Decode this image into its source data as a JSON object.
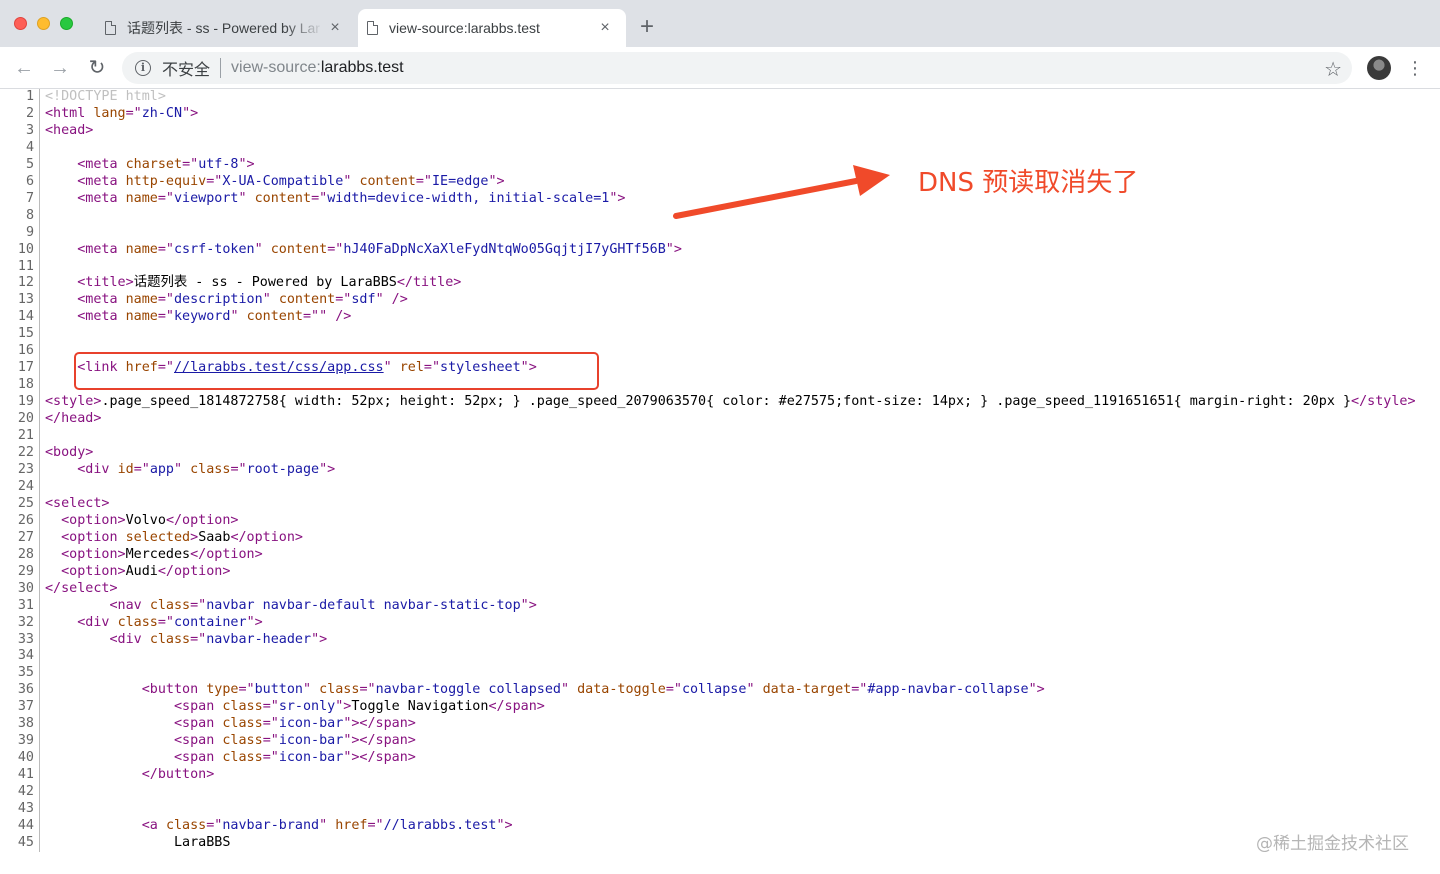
{
  "tabs": [
    {
      "title": "话题列表 - ss - Powered by Lar",
      "close": "×"
    },
    {
      "title": "view-source:larabbs.test",
      "close": "×"
    }
  ],
  "new_tab": "+",
  "toolbar": {
    "back": "←",
    "forward": "→",
    "reload": "↻",
    "info": "i",
    "security_label": "不安全",
    "url_scheme": "view-source:",
    "url_host": "larabbs.test",
    "star": "☆",
    "menu": "⋮"
  },
  "source_lines": [
    {
      "n": "1",
      "segs": [
        {
          "c": "doct",
          "t": "<!DOCTYPE html>"
        }
      ]
    },
    {
      "n": "2",
      "segs": [
        {
          "c": "tag",
          "t": "<html "
        },
        {
          "c": "an",
          "t": "lang"
        },
        {
          "c": "tag",
          "t": "=\""
        },
        {
          "c": "av",
          "t": "zh-CN"
        },
        {
          "c": "tag",
          "t": "\">"
        }
      ]
    },
    {
      "n": "3",
      "segs": [
        {
          "c": "tag",
          "t": "<head>"
        }
      ]
    },
    {
      "n": "4",
      "segs": []
    },
    {
      "n": "5",
      "segs": [
        {
          "c": "",
          "t": "    "
        },
        {
          "c": "tag",
          "t": "<meta "
        },
        {
          "c": "an",
          "t": "charset"
        },
        {
          "c": "tag",
          "t": "=\""
        },
        {
          "c": "av",
          "t": "utf-8"
        },
        {
          "c": "tag",
          "t": "\">"
        }
      ]
    },
    {
      "n": "6",
      "segs": [
        {
          "c": "",
          "t": "    "
        },
        {
          "c": "tag",
          "t": "<meta "
        },
        {
          "c": "an",
          "t": "http-equiv"
        },
        {
          "c": "tag",
          "t": "=\""
        },
        {
          "c": "av",
          "t": "X-UA-Compatible"
        },
        {
          "c": "tag",
          "t": "\" "
        },
        {
          "c": "an",
          "t": "content"
        },
        {
          "c": "tag",
          "t": "=\""
        },
        {
          "c": "av",
          "t": "IE=edge"
        },
        {
          "c": "tag",
          "t": "\">"
        }
      ]
    },
    {
      "n": "7",
      "segs": [
        {
          "c": "",
          "t": "    "
        },
        {
          "c": "tag",
          "t": "<meta "
        },
        {
          "c": "an",
          "t": "name"
        },
        {
          "c": "tag",
          "t": "=\""
        },
        {
          "c": "av",
          "t": "viewport"
        },
        {
          "c": "tag",
          "t": "\" "
        },
        {
          "c": "an",
          "t": "content"
        },
        {
          "c": "tag",
          "t": "=\""
        },
        {
          "c": "av",
          "t": "width=device-width, initial-scale=1"
        },
        {
          "c": "tag",
          "t": "\">"
        }
      ]
    },
    {
      "n": "8",
      "segs": []
    },
    {
      "n": "9",
      "segs": []
    },
    {
      "n": "10",
      "segs": [
        {
          "c": "",
          "t": "    "
        },
        {
          "c": "tag",
          "t": "<meta "
        },
        {
          "c": "an",
          "t": "name"
        },
        {
          "c": "tag",
          "t": "=\""
        },
        {
          "c": "av",
          "t": "csrf-token"
        },
        {
          "c": "tag",
          "t": "\" "
        },
        {
          "c": "an",
          "t": "content"
        },
        {
          "c": "tag",
          "t": "=\""
        },
        {
          "c": "av",
          "t": "hJ40FaDpNcXaXleFydNtqWo05GqjtjI7yGHTf56B"
        },
        {
          "c": "tag",
          "t": "\">"
        }
      ]
    },
    {
      "n": "11",
      "segs": []
    },
    {
      "n": "12",
      "segs": [
        {
          "c": "",
          "t": "    "
        },
        {
          "c": "tag",
          "t": "<title>"
        },
        {
          "c": "",
          "t": "话题列表 - ss - Powered by LaraBBS"
        },
        {
          "c": "tag",
          "t": "</title>"
        }
      ]
    },
    {
      "n": "13",
      "segs": [
        {
          "c": "",
          "t": "    "
        },
        {
          "c": "tag",
          "t": "<meta "
        },
        {
          "c": "an",
          "t": "name"
        },
        {
          "c": "tag",
          "t": "=\""
        },
        {
          "c": "av",
          "t": "description"
        },
        {
          "c": "tag",
          "t": "\" "
        },
        {
          "c": "an",
          "t": "content"
        },
        {
          "c": "tag",
          "t": "=\""
        },
        {
          "c": "av",
          "t": "sdf"
        },
        {
          "c": "tag",
          "t": "\" />"
        }
      ]
    },
    {
      "n": "14",
      "segs": [
        {
          "c": "",
          "t": "    "
        },
        {
          "c": "tag",
          "t": "<meta "
        },
        {
          "c": "an",
          "t": "name"
        },
        {
          "c": "tag",
          "t": "=\""
        },
        {
          "c": "av",
          "t": "keyword"
        },
        {
          "c": "tag",
          "t": "\" "
        },
        {
          "c": "an",
          "t": "content"
        },
        {
          "c": "tag",
          "t": "=\"\" />"
        }
      ]
    },
    {
      "n": "15",
      "segs": []
    },
    {
      "n": "16",
      "segs": []
    },
    {
      "n": "17",
      "segs": [
        {
          "c": "",
          "t": "    "
        },
        {
          "c": "tag",
          "t": "<link "
        },
        {
          "c": "an",
          "t": "href"
        },
        {
          "c": "tag",
          "t": "=\""
        },
        {
          "c": "lnk",
          "t": "//larabbs.test/css/app.css"
        },
        {
          "c": "tag",
          "t": "\" "
        },
        {
          "c": "an",
          "t": "rel"
        },
        {
          "c": "tag",
          "t": "=\""
        },
        {
          "c": "av",
          "t": "stylesheet"
        },
        {
          "c": "tag",
          "t": "\">"
        }
      ]
    },
    {
      "n": "18",
      "segs": []
    },
    {
      "n": "19",
      "wrap": true,
      "segs": [
        {
          "c": "tag",
          "t": "<style>"
        },
        {
          "c": "",
          "t": ".page_speed_1814872758{ width: 52px; height: 52px; } .page_speed_2079063570{ color: #e27575;font-size: 14px; } .page_speed_1191651651{ margin-right: 20px }"
        },
        {
          "c": "tag",
          "t": "</style>"
        }
      ]
    },
    {
      "n": "20",
      "segs": [
        {
          "c": "tag",
          "t": "</head>"
        }
      ]
    },
    {
      "n": "21",
      "segs": []
    },
    {
      "n": "22",
      "segs": [
        {
          "c": "tag",
          "t": "<body>"
        }
      ]
    },
    {
      "n": "23",
      "segs": [
        {
          "c": "",
          "t": "    "
        },
        {
          "c": "tag",
          "t": "<div "
        },
        {
          "c": "an",
          "t": "id"
        },
        {
          "c": "tag",
          "t": "=\""
        },
        {
          "c": "av",
          "t": "app"
        },
        {
          "c": "tag",
          "t": "\" "
        },
        {
          "c": "an",
          "t": "class"
        },
        {
          "c": "tag",
          "t": "=\""
        },
        {
          "c": "av",
          "t": "root-page"
        },
        {
          "c": "tag",
          "t": "\">"
        }
      ]
    },
    {
      "n": "24",
      "segs": []
    },
    {
      "n": "25",
      "segs": [
        {
          "c": "tag",
          "t": "<select>"
        }
      ]
    },
    {
      "n": "26",
      "segs": [
        {
          "c": "",
          "t": "  "
        },
        {
          "c": "tag",
          "t": "<option>"
        },
        {
          "c": "",
          "t": "Volvo"
        },
        {
          "c": "tag",
          "t": "</option>"
        }
      ]
    },
    {
      "n": "27",
      "segs": [
        {
          "c": "",
          "t": "  "
        },
        {
          "c": "tag",
          "t": "<option "
        },
        {
          "c": "an",
          "t": "selected"
        },
        {
          "c": "tag",
          "t": ">"
        },
        {
          "c": "",
          "t": "Saab"
        },
        {
          "c": "tag",
          "t": "</option>"
        }
      ]
    },
    {
      "n": "28",
      "segs": [
        {
          "c": "",
          "t": "  "
        },
        {
          "c": "tag",
          "t": "<option>"
        },
        {
          "c": "",
          "t": "Mercedes"
        },
        {
          "c": "tag",
          "t": "</option>"
        }
      ]
    },
    {
      "n": "29",
      "segs": [
        {
          "c": "",
          "t": "  "
        },
        {
          "c": "tag",
          "t": "<option>"
        },
        {
          "c": "",
          "t": "Audi"
        },
        {
          "c": "tag",
          "t": "</option>"
        }
      ]
    },
    {
      "n": "30",
      "segs": [
        {
          "c": "tag",
          "t": "</select>"
        }
      ]
    },
    {
      "n": "31",
      "segs": [
        {
          "c": "",
          "t": "        "
        },
        {
          "c": "tag",
          "t": "<nav "
        },
        {
          "c": "an",
          "t": "class"
        },
        {
          "c": "tag",
          "t": "=\""
        },
        {
          "c": "av",
          "t": "navbar navbar-default navbar-static-top"
        },
        {
          "c": "tag",
          "t": "\">"
        }
      ]
    },
    {
      "n": "32",
      "segs": [
        {
          "c": "",
          "t": "    "
        },
        {
          "c": "tag",
          "t": "<div "
        },
        {
          "c": "an",
          "t": "class"
        },
        {
          "c": "tag",
          "t": "=\""
        },
        {
          "c": "av",
          "t": "container"
        },
        {
          "c": "tag",
          "t": "\">"
        }
      ]
    },
    {
      "n": "33",
      "segs": [
        {
          "c": "",
          "t": "        "
        },
        {
          "c": "tag",
          "t": "<div "
        },
        {
          "c": "an",
          "t": "class"
        },
        {
          "c": "tag",
          "t": "=\""
        },
        {
          "c": "av",
          "t": "navbar-header"
        },
        {
          "c": "tag",
          "t": "\">"
        }
      ]
    },
    {
      "n": "34",
      "segs": []
    },
    {
      "n": "35",
      "segs": []
    },
    {
      "n": "36",
      "segs": [
        {
          "c": "",
          "t": "            "
        },
        {
          "c": "tag",
          "t": "<button "
        },
        {
          "c": "an",
          "t": "type"
        },
        {
          "c": "tag",
          "t": "=\""
        },
        {
          "c": "av",
          "t": "button"
        },
        {
          "c": "tag",
          "t": "\" "
        },
        {
          "c": "an",
          "t": "class"
        },
        {
          "c": "tag",
          "t": "=\""
        },
        {
          "c": "av",
          "t": "navbar-toggle collapsed"
        },
        {
          "c": "tag",
          "t": "\" "
        },
        {
          "c": "an",
          "t": "data-toggle"
        },
        {
          "c": "tag",
          "t": "=\""
        },
        {
          "c": "av",
          "t": "collapse"
        },
        {
          "c": "tag",
          "t": "\" "
        },
        {
          "c": "an",
          "t": "data-target"
        },
        {
          "c": "tag",
          "t": "=\""
        },
        {
          "c": "av",
          "t": "#app-navbar-collapse"
        },
        {
          "c": "tag",
          "t": "\">"
        }
      ]
    },
    {
      "n": "37",
      "segs": [
        {
          "c": "",
          "t": "                "
        },
        {
          "c": "tag",
          "t": "<span "
        },
        {
          "c": "an",
          "t": "class"
        },
        {
          "c": "tag",
          "t": "=\""
        },
        {
          "c": "av",
          "t": "sr-only"
        },
        {
          "c": "tag",
          "t": "\">"
        },
        {
          "c": "",
          "t": "Toggle Navigation"
        },
        {
          "c": "tag",
          "t": "</span>"
        }
      ]
    },
    {
      "n": "38",
      "segs": [
        {
          "c": "",
          "t": "                "
        },
        {
          "c": "tag",
          "t": "<span "
        },
        {
          "c": "an",
          "t": "class"
        },
        {
          "c": "tag",
          "t": "=\""
        },
        {
          "c": "av",
          "t": "icon-bar"
        },
        {
          "c": "tag",
          "t": "\"></span>"
        }
      ]
    },
    {
      "n": "39",
      "segs": [
        {
          "c": "",
          "t": "                "
        },
        {
          "c": "tag",
          "t": "<span "
        },
        {
          "c": "an",
          "t": "class"
        },
        {
          "c": "tag",
          "t": "=\""
        },
        {
          "c": "av",
          "t": "icon-bar"
        },
        {
          "c": "tag",
          "t": "\"></span>"
        }
      ]
    },
    {
      "n": "40",
      "segs": [
        {
          "c": "",
          "t": "                "
        },
        {
          "c": "tag",
          "t": "<span "
        },
        {
          "c": "an",
          "t": "class"
        },
        {
          "c": "tag",
          "t": "=\""
        },
        {
          "c": "av",
          "t": "icon-bar"
        },
        {
          "c": "tag",
          "t": "\"></span>"
        }
      ]
    },
    {
      "n": "41",
      "segs": [
        {
          "c": "",
          "t": "            "
        },
        {
          "c": "tag",
          "t": "</button>"
        }
      ]
    },
    {
      "n": "42",
      "segs": []
    },
    {
      "n": "43",
      "segs": []
    },
    {
      "n": "44",
      "segs": [
        {
          "c": "",
          "t": "            "
        },
        {
          "c": "tag",
          "t": "<a "
        },
        {
          "c": "an",
          "t": "class"
        },
        {
          "c": "tag",
          "t": "=\""
        },
        {
          "c": "av",
          "t": "navbar-brand"
        },
        {
          "c": "tag",
          "t": "\" "
        },
        {
          "c": "an",
          "t": "href"
        },
        {
          "c": "tag",
          "t": "=\""
        },
        {
          "c": "av",
          "t": "//larabbs.test"
        },
        {
          "c": "tag",
          "t": "\">"
        }
      ]
    },
    {
      "n": "45",
      "segs": [
        {
          "c": "",
          "t": "                LaraBBS"
        }
      ]
    }
  ],
  "annotation": "DNS 预读取消失了",
  "watermark": "@稀土掘金技术社区",
  "colors": {
    "annotation": "#f04a2a",
    "tag": "#881280",
    "attr_name": "#994500",
    "attr_value": "#1a1aa6"
  }
}
